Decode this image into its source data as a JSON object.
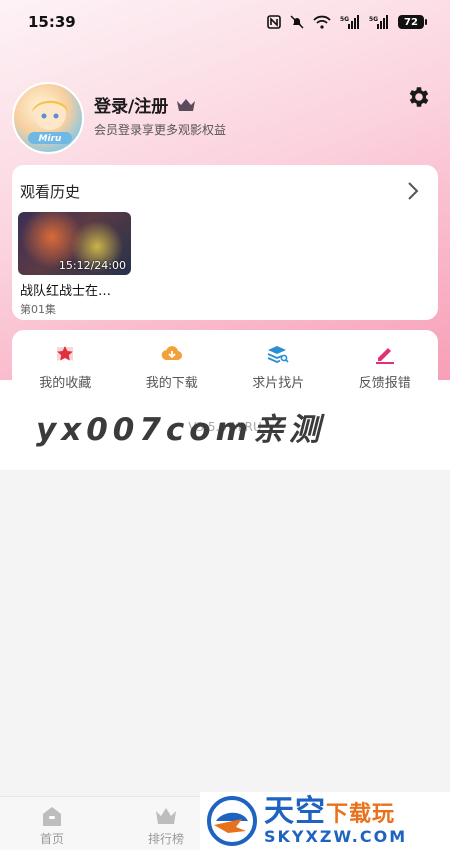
{
  "status_bar": {
    "time": "15:39",
    "signal1_label": "5G",
    "signal2_label": "5G",
    "battery": "72"
  },
  "profile": {
    "username": "登录/注册",
    "subtitle": "会员登录享更多观影权益",
    "avatar_text": "Miru"
  },
  "history": {
    "title": "观看历史",
    "items": [
      {
        "time": "15:12/24:00",
        "title": "战队红战士在…",
        "episode": "第01集"
      }
    ]
  },
  "actions": [
    {
      "label": "我的收藏",
      "icon": "star-icon",
      "color": "#e0303f"
    },
    {
      "label": "我的下载",
      "icon": "download-icon",
      "color": "#f2a13a"
    },
    {
      "label": "求片找片",
      "icon": "search-stack-icon",
      "color": "#2a8fd6"
    },
    {
      "label": "反馈报错",
      "icon": "edit-icon",
      "color": "#e0307a"
    }
  ],
  "version": "V3.5.5 MIRU",
  "watermark": "yx007com亲测",
  "nav": {
    "home": "首页",
    "rank": "排行榜"
  },
  "brand": {
    "cn_main": "天空",
    "cn_accent": "下载玩",
    "en": "SKYXZW.COM"
  },
  "colors": {
    "accent_pink": "#f78fab",
    "brand_blue": "#1e63c2"
  }
}
